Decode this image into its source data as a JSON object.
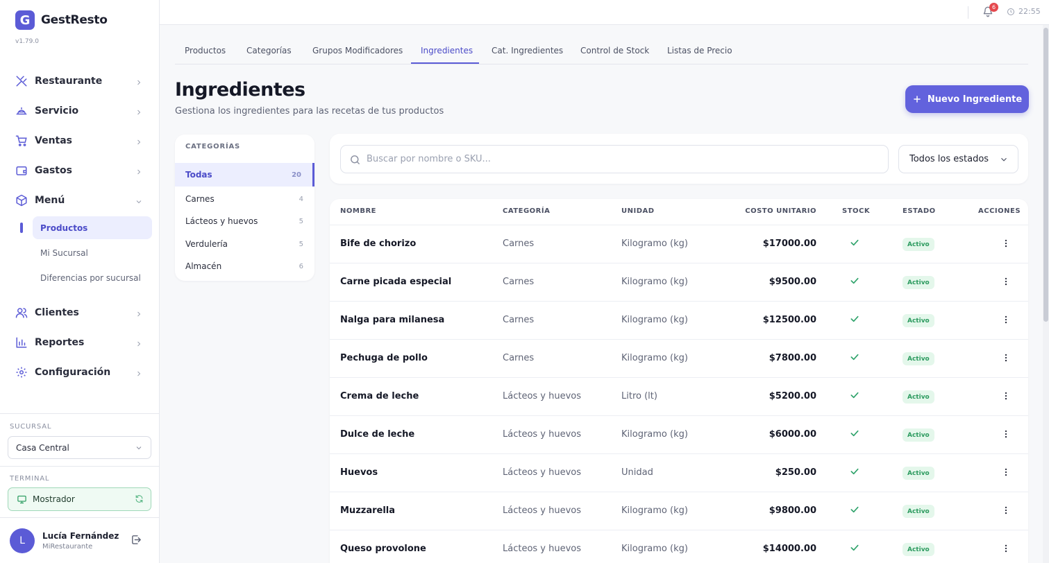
{
  "app": {
    "logo_letter": "G",
    "name": "GestResto",
    "version": "v1.79.0"
  },
  "sidebar": {
    "nav": [
      {
        "label": "Restaurante",
        "icon": "utensils-icon"
      },
      {
        "label": "Servicio",
        "icon": "cloche-icon"
      },
      {
        "label": "Ventas",
        "icon": "cart-icon"
      },
      {
        "label": "Gastos",
        "icon": "wallet-icon"
      },
      {
        "label": "Menú",
        "icon": "box-icon"
      },
      {
        "label": "Clientes",
        "icon": "users-icon"
      },
      {
        "label": "Reportes",
        "icon": "bar-chart-icon"
      },
      {
        "label": "Configuración",
        "icon": "gear-icon"
      }
    ],
    "menu_sub": [
      "Productos",
      "Mi Sucursal",
      "Diferencias por sucursal"
    ],
    "sucursal_label": "SUCURSAL",
    "sucursal_value": "Casa Central",
    "terminal_label": "TERMINAL",
    "terminal_value": "Mostrador",
    "user": {
      "initial": "L",
      "name": "Lucía Fernández",
      "org": "MiRestaurante"
    }
  },
  "topbar": {
    "notifications": "6",
    "time": "22:55"
  },
  "tabs": [
    "Productos",
    "Categorías",
    "Grupos Modificadores",
    "Ingredientes",
    "Cat. Ingredientes",
    "Control de Stock",
    "Listas de Precio"
  ],
  "page": {
    "title": "Ingredientes",
    "subtitle": "Gestiona los ingredientes para las recetas de tus productos",
    "new_button": "Nuevo Ingrediente"
  },
  "categories": {
    "header": "CATEGORÍAS",
    "items": [
      {
        "label": "Todas",
        "count": "20"
      },
      {
        "label": "Carnes",
        "count": "4"
      },
      {
        "label": "Lácteos y huevos",
        "count": "5"
      },
      {
        "label": "Verdulería",
        "count": "5"
      },
      {
        "label": "Almacén",
        "count": "6"
      }
    ]
  },
  "search": {
    "placeholder": "Buscar por nombre o SKU...",
    "status_filter": "Todos los estados"
  },
  "table": {
    "headers": {
      "name": "NOMBRE",
      "category": "CATEGORÍA",
      "unit": "UNIDAD",
      "cost": "COSTO UNITARIO",
      "stock": "STOCK",
      "status": "ESTADO",
      "actions": "ACCIONES"
    },
    "rows": [
      {
        "name": "Bife de chorizo",
        "category": "Carnes",
        "unit": "Kilogramo (kg)",
        "cost": "$17000.00",
        "status": "Activo"
      },
      {
        "name": "Carne picada especial",
        "category": "Carnes",
        "unit": "Kilogramo (kg)",
        "cost": "$9500.00",
        "status": "Activo"
      },
      {
        "name": "Nalga para milanesa",
        "category": "Carnes",
        "unit": "Kilogramo (kg)",
        "cost": "$12500.00",
        "status": "Activo"
      },
      {
        "name": "Pechuga de pollo",
        "category": "Carnes",
        "unit": "Kilogramo (kg)",
        "cost": "$7800.00",
        "status": "Activo"
      },
      {
        "name": "Crema de leche",
        "category": "Lácteos y huevos",
        "unit": "Litro (lt)",
        "cost": "$5200.00",
        "status": "Activo"
      },
      {
        "name": "Dulce de leche",
        "category": "Lácteos y huevos",
        "unit": "Kilogramo (kg)",
        "cost": "$6000.00",
        "status": "Activo"
      },
      {
        "name": "Huevos",
        "category": "Lácteos y huevos",
        "unit": "Unidad",
        "cost": "$250.00",
        "status": "Activo"
      },
      {
        "name": "Muzzarella",
        "category": "Lácteos y huevos",
        "unit": "Kilogramo (kg)",
        "cost": "$9800.00",
        "status": "Activo"
      },
      {
        "name": "Queso provolone",
        "category": "Lácteos y huevos",
        "unit": "Kilogramo (kg)",
        "cost": "$14000.00",
        "status": "Activo"
      }
    ]
  }
}
